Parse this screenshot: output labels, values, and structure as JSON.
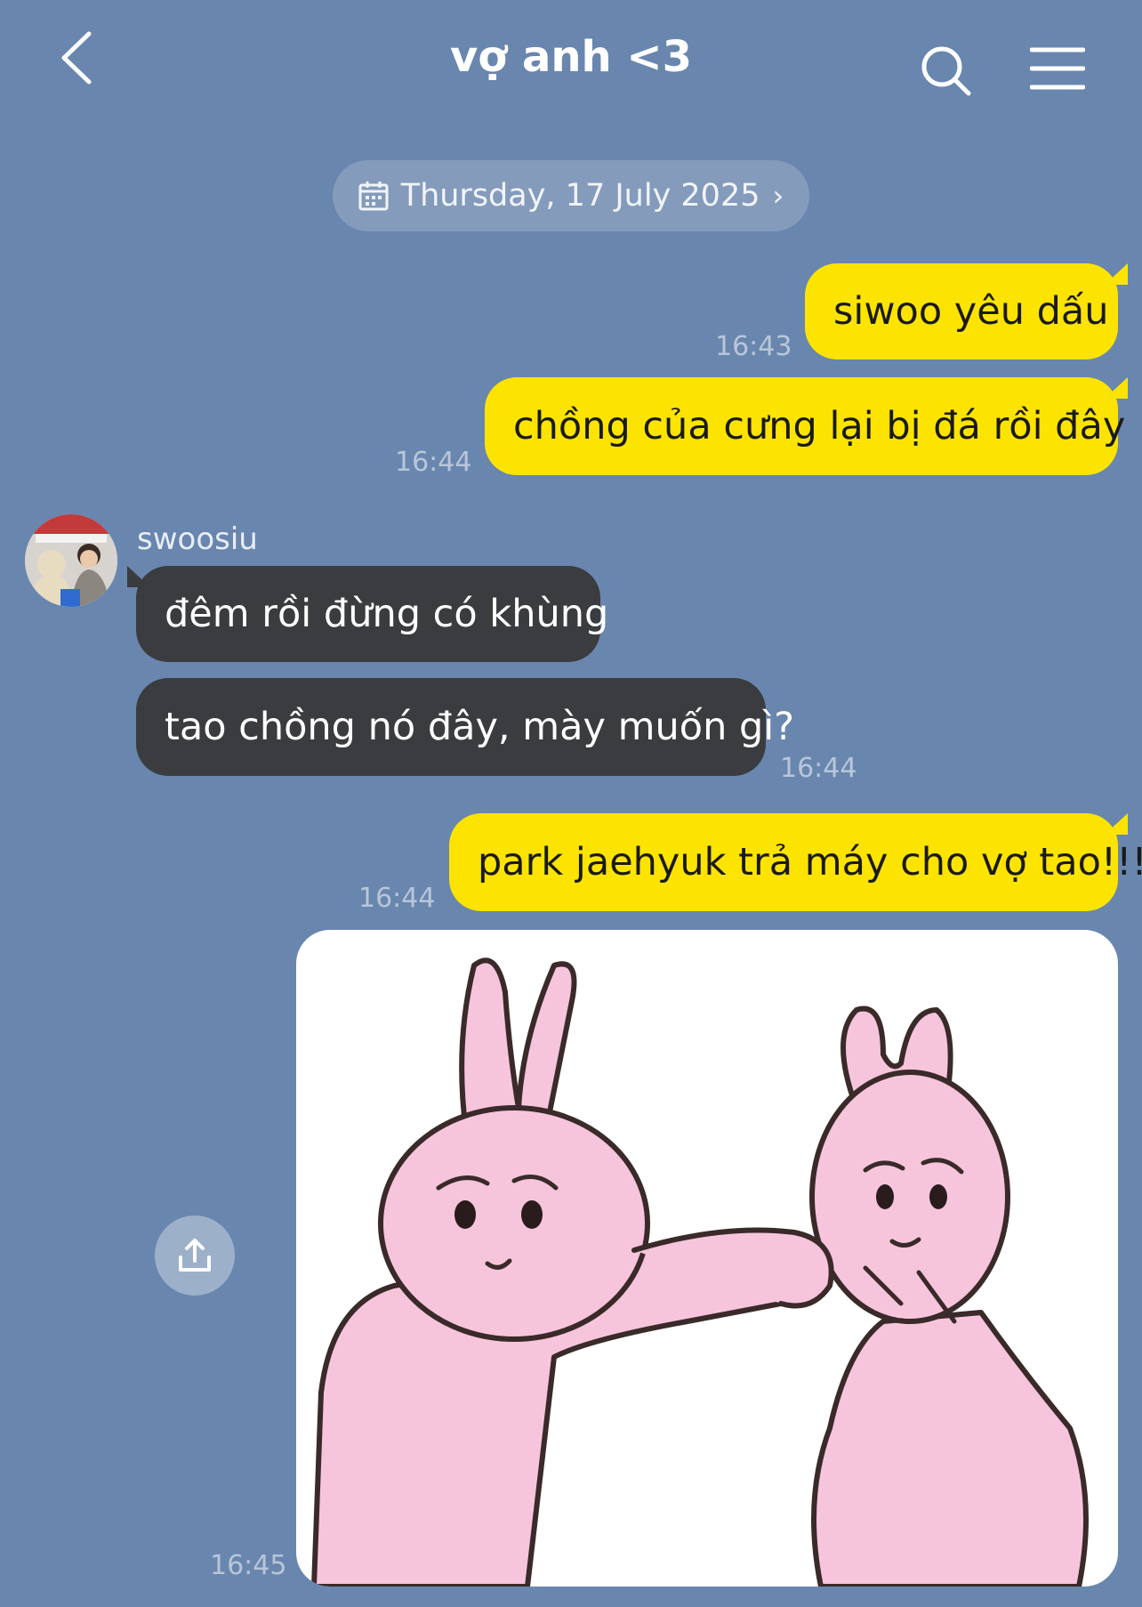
{
  "header": {
    "title": "vợ anh <3",
    "back_icon": "chevron-left-icon",
    "search_icon": "search-icon",
    "menu_icon": "hamburger-menu-icon"
  },
  "date_divider": {
    "label": "Thursday, 17 July 2025",
    "icon": "calendar-icon",
    "chevron_icon": "chevron-right-icon"
  },
  "messages": [
    {
      "direction": "out",
      "text": "siwoo yêu dấu",
      "time": "16:43"
    },
    {
      "direction": "out",
      "text": "chồng của cưng lại bị đá rồi đây",
      "time": "16:44"
    },
    {
      "direction": "in",
      "sender": "swoosiu",
      "text": "đêm rồi đừng có khùng"
    },
    {
      "direction": "in",
      "text": "tao chồng nó đây, mày muốn gì?",
      "time": "16:44"
    },
    {
      "direction": "out",
      "text": "park jaehyuk trả máy cho vợ tao!!!",
      "time": "16:44"
    },
    {
      "direction": "out",
      "type": "sticker",
      "time": "16:45"
    }
  ],
  "colors": {
    "background": "#6986ae",
    "outgoing_bubble": "#fde400",
    "incoming_bubble": "#3b3c3f",
    "sticker_pink": "#f6c5db"
  },
  "share_icon": "share-upload-icon"
}
